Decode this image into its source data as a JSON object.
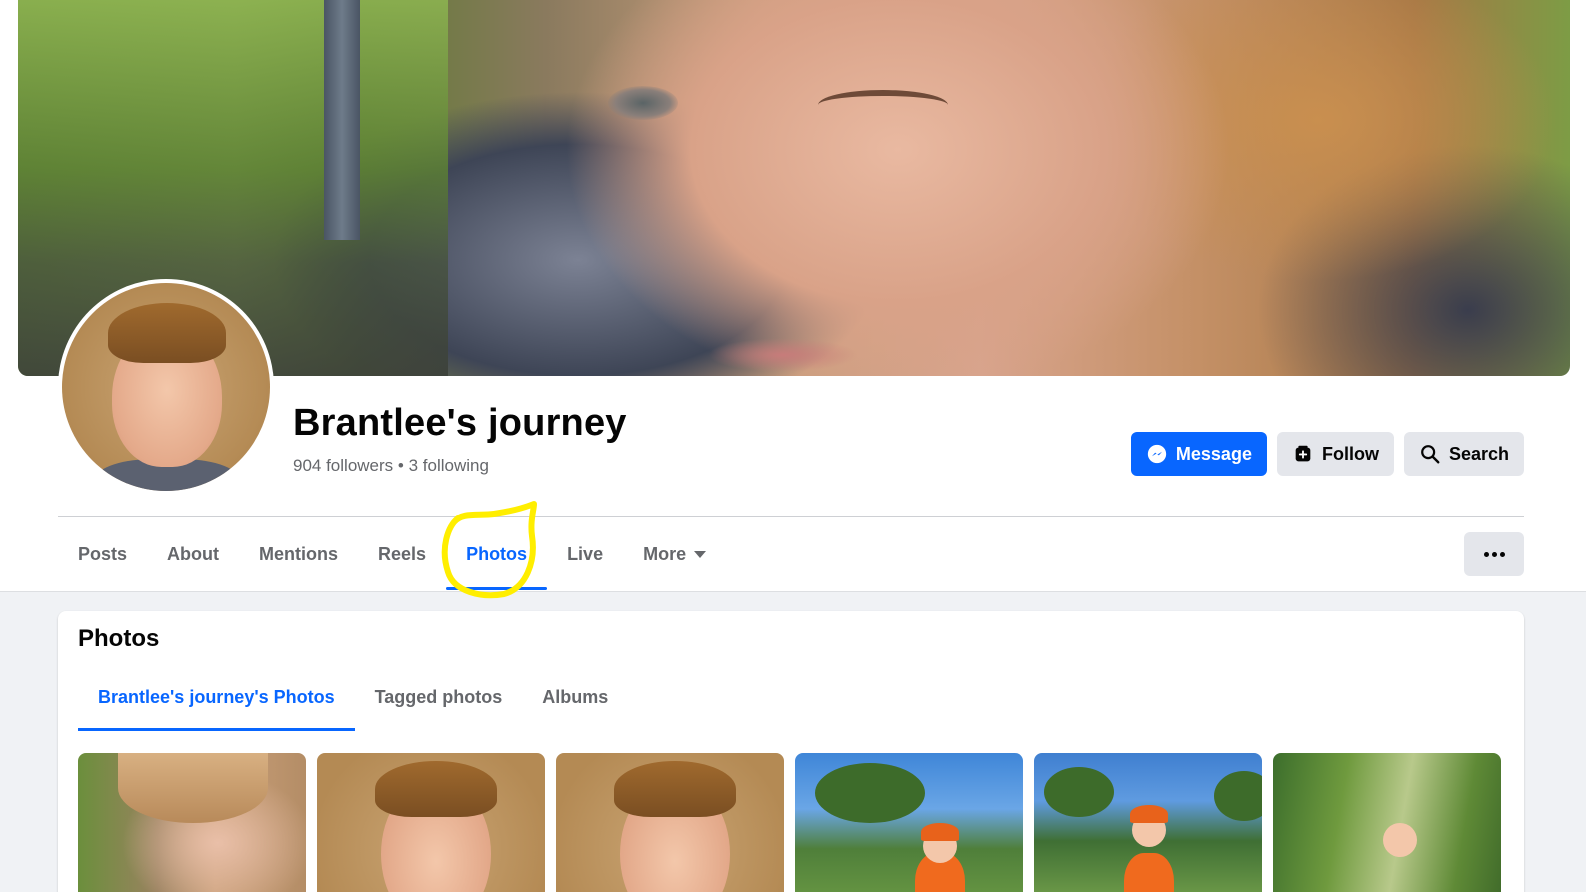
{
  "profile": {
    "name": "Brantlee's journey",
    "followers": "904 followers",
    "separator": "•",
    "following": "3 following"
  },
  "actions": {
    "message": "Message",
    "follow": "Follow",
    "search": "Search"
  },
  "tabs": [
    {
      "label": "Posts"
    },
    {
      "label": "About"
    },
    {
      "label": "Mentions"
    },
    {
      "label": "Reels"
    },
    {
      "label": "Photos",
      "active": true
    },
    {
      "label": "Live"
    },
    {
      "label": "More"
    }
  ],
  "photos_section": {
    "title": "Photos",
    "subtabs": [
      {
        "label": "Brantlee's journey's Photos",
        "active": true
      },
      {
        "label": "Tagged photos"
      },
      {
        "label": "Albums"
      }
    ]
  },
  "colors": {
    "accent": "#0866ff",
    "highlight_annotation": "#ffee00"
  },
  "icons": {
    "message": "messenger-icon",
    "follow": "add-follow-icon",
    "search": "search-icon",
    "more": "caret-down-icon",
    "overflow": "ellipsis-icon"
  }
}
